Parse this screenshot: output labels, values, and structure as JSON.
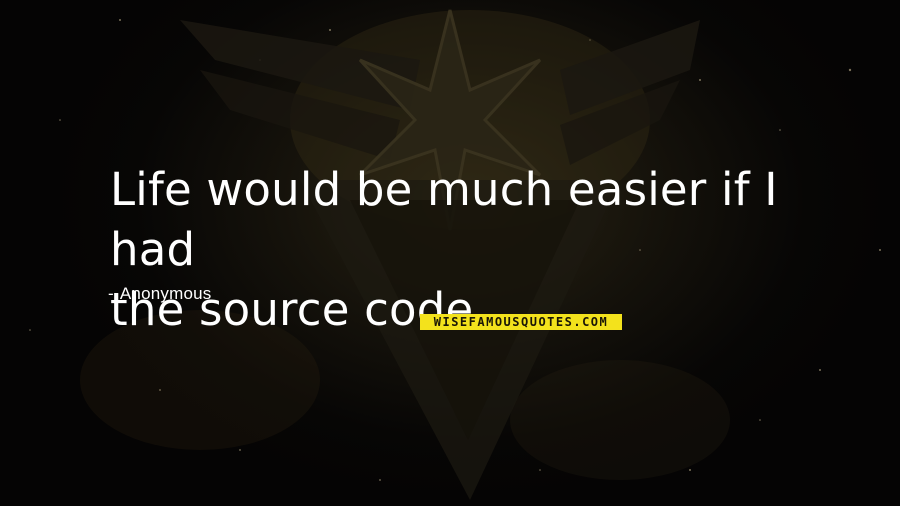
{
  "quote": {
    "line1": "Life would be much easier if I had",
    "line2": "the source code."
  },
  "author": {
    "dash": "-",
    "name": "Anonymous"
  },
  "watermark": {
    "text": "WISEFAMOUSQUOTES.COM",
    "background_color": "#f3e21c"
  },
  "background": {
    "description_icon": "team-instinct-emblem",
    "base_color": "#0a0806"
  }
}
